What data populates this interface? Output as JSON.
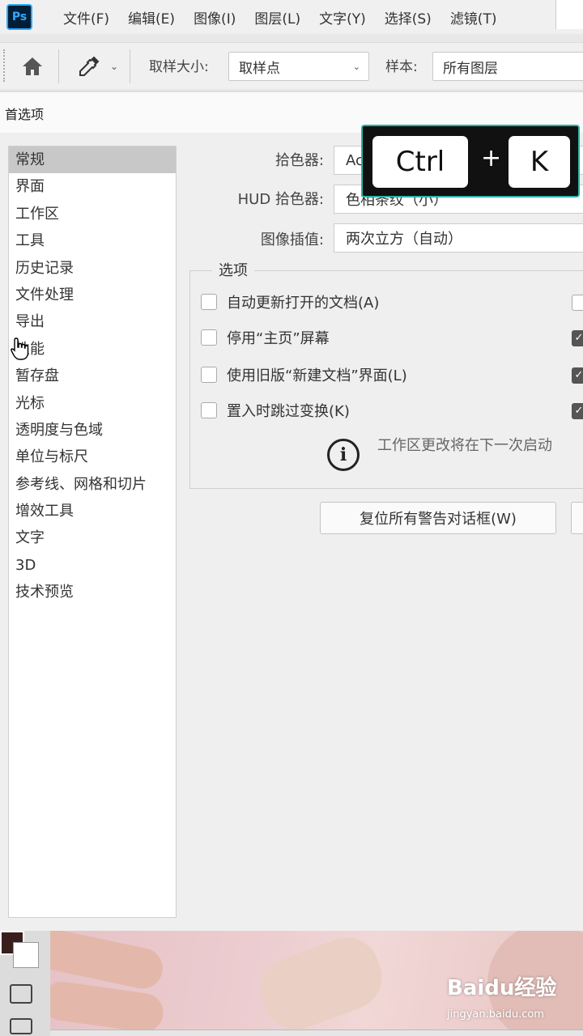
{
  "menubar": {
    "logo": "Ps",
    "items": [
      "文件(F)",
      "编辑(E)",
      "图像(I)",
      "图层(L)",
      "文字(Y)",
      "选择(S)",
      "滤镜(T)"
    ]
  },
  "options_bar": {
    "home_icon": "home-icon",
    "tool_icon": "eyedropper-icon",
    "sample_size_label": "取样大小:",
    "sample_size_value": "取样点",
    "sample_label": "样本:",
    "sample_value": "所有图层"
  },
  "dialog": {
    "title": "首选项",
    "sidebar": [
      {
        "label": "常规",
        "active": true
      },
      {
        "label": "界面"
      },
      {
        "label": "工作区"
      },
      {
        "label": "工具"
      },
      {
        "label": "历史记录"
      },
      {
        "label": "文件处理"
      },
      {
        "label": "导出"
      },
      {
        "label": "性能"
      },
      {
        "label": "暂存盘"
      },
      {
        "label": "光标"
      },
      {
        "label": "透明度与色域"
      },
      {
        "label": "单位与标尺"
      },
      {
        "label": "参考线、网格和切片"
      },
      {
        "label": "增效工具"
      },
      {
        "label": "文字"
      },
      {
        "label": "3D"
      },
      {
        "label": "技术预览"
      }
    ],
    "fields": {
      "color_picker_label": "拾色器:",
      "color_picker_value": "Ac",
      "hud_label": "HUD 拾色器:",
      "hud_value": "色相条纹（小）",
      "interp_label": "图像插值:",
      "interp_value": "两次立方（自动）"
    },
    "options_group": {
      "legend": "选项",
      "checkboxes": [
        {
          "label": "自动更新打开的文档(A)",
          "checked": false,
          "right_checked": false
        },
        {
          "label": "停用“主页”屏幕",
          "checked": false,
          "right_checked": true
        },
        {
          "label": "使用旧版“新建文档”界面(L)",
          "checked": false,
          "right_checked": true
        },
        {
          "label": "置入时跳过变换(K)",
          "checked": false,
          "right_checked": true
        }
      ],
      "info_text": "工作区更改将在下一次启动"
    },
    "reset_button": "复位所有警告对话框(W)"
  },
  "shortcut_overlay": {
    "key1": "Ctrl",
    "plus": "+",
    "key2": "K"
  },
  "watermark": {
    "brand": "Baidu经验",
    "url": "jingyan.baidu.com"
  }
}
